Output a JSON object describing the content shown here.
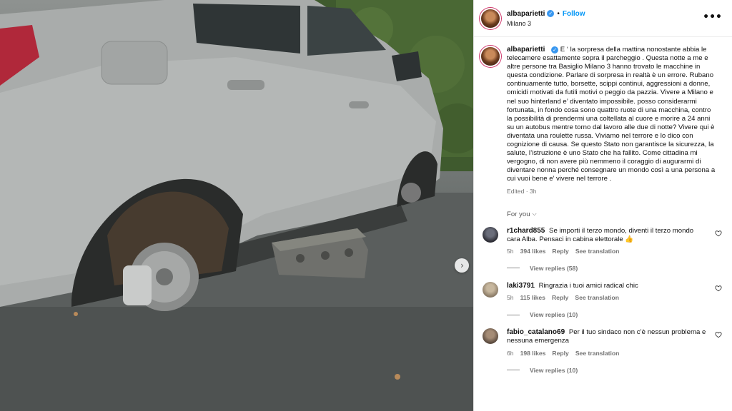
{
  "post": {
    "username": "albaparietti",
    "follow_label": "Follow",
    "location": "Milano 3",
    "more_label": "•••",
    "caption": "E ‘ la sorpresa della mattina nonostante abbia le telecamere esattamente sopra il parcheggio . Questa notte a me e altre persone tra Basiglio Milano 3 hanno trovato le macchine in questa condizione. Parlare di sorpresa in realtà è un errore. Rubano continuamente tutto, borsette, scippi continui, aggressioni a donne, omicidi motivati da futili motivi o peggio da pazzia. Vivere a Milano e nel suo hinterland e’ diventato impossibile. posso considerarmi fortunata, in fondo cosa sono quattro ruote di una macchina, contro la possibilità di prendermi una coltellata al cuore e morire a 24 anni su un autobus mentre torno dal lavoro alle due di notte? Vivere qui è diventata una roulette russa. Viviamo nel terrore e lo dico con cognizione di causa. Se questo Stato non garantisce la sicurezza, la salute, l’istruzione è uno Stato che ha fallito. Come cittadina mi vergogno, di non avere più nemmeno il coraggio di augurarmi di diventare nonna perché consegnare un mondo così a una persona a cui vuoi bene e’ vivere nel terrore .",
    "edited": "Edited · 3h",
    "next_icon": "chevron-right-icon",
    "next_glyph": "›"
  },
  "comments_header": {
    "label": "For you",
    "chevron": "⌵"
  },
  "comments": [
    {
      "username": "r1chard855",
      "text": "Se importi il terzo mondo, diventi il terzo mondo cara Alba. Pensaci in cabina elettorale 👍",
      "time": "5h",
      "likes": "394 likes",
      "reply": "Reply",
      "translate": "See translation",
      "replies": "View replies (58)",
      "avatar_color": "#2c2c34"
    },
    {
      "username": "laki3791",
      "text": "Ringrazia i tuoi amici radical chic",
      "time": "5h",
      "likes": "115 likes",
      "reply": "Reply",
      "translate": "See translation",
      "replies": "View replies (10)",
      "avatar_color": "#8a7a66"
    },
    {
      "username": "fabio_catalano69",
      "text": "Per il tuo sindaco non c’è nessun problema e nessuna emergenza",
      "time": "6h",
      "likes": "198 likes",
      "reply": "Reply",
      "translate": "See translation",
      "replies": "View replies (10)",
      "avatar_color": "#5a4a3e"
    }
  ],
  "colors": {
    "link_blue": "#0095f6",
    "verified_blue": "#3897f0",
    "meta_gray": "#737373"
  }
}
